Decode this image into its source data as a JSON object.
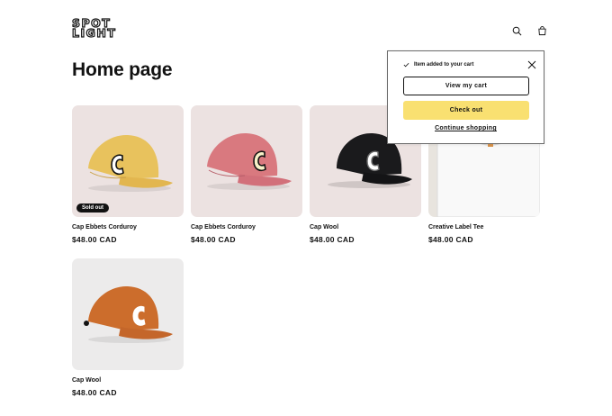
{
  "brand": {
    "logo_line1": "SPOT",
    "logo_line2": "LIGHT"
  },
  "header": {
    "icons": [
      "search-icon",
      "cart-icon"
    ]
  },
  "page": {
    "title": "Home page"
  },
  "products": [
    {
      "name": "Cap Ebbets Corduroy",
      "price": "$48.00 CAD",
      "badge": "Sold out",
      "bg": "#ece2e1",
      "cap_color": "#e8c25d",
      "visor_color": "#e2b64f",
      "letter_fill": "#ffffff",
      "image": "yellow cap"
    },
    {
      "name": "Cap Ebbets Corduroy",
      "price": "$48.00 CAD",
      "bg": "#ece2e1",
      "cap_color": "#d9797f",
      "visor_color": "#d2707a",
      "letter_fill": "#f7f1c8",
      "image": "pink cap"
    },
    {
      "name": "Cap Wool",
      "price": "$48.00 CAD",
      "bg": "#ece2e1",
      "cap_color": "#1a1a1c",
      "visor_color": "#141416",
      "letter_fill": "#ffffff",
      "image": "black cap"
    },
    {
      "name": "Creative Label Tee",
      "price": "$48.00 CAD",
      "bg": "#e8e4de",
      "image": "white tee"
    },
    {
      "name": "Cap Wool",
      "price": "$48.00 CAD",
      "bg": "#ecebeb",
      "cap_color": "#cc6d2c",
      "visor_color": "#c4662a",
      "letter_fill": "#ffffff",
      "image": "orange cap"
    }
  ],
  "cart_notification": {
    "message": "Item added to your cart",
    "view_cart": "View my cart",
    "checkout": "Check out",
    "continue": "Continue shopping"
  },
  "colors": {
    "checkout_button": "#f9e071",
    "text": "#121212",
    "badge": "#121212"
  }
}
